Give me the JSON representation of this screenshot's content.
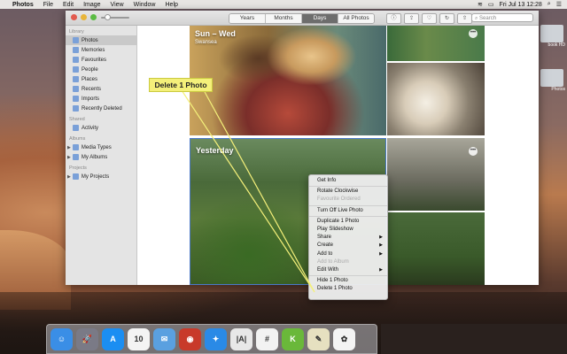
{
  "menubar": {
    "app_name": "Photos",
    "items": [
      "File",
      "Edit",
      "Image",
      "View",
      "Window",
      "Help"
    ],
    "clock": "Fri Jul 13  12:28"
  },
  "toolbar": {
    "segments": [
      {
        "label": "Years",
        "active": false
      },
      {
        "label": "Months",
        "active": false
      },
      {
        "label": "Days",
        "active": true
      },
      {
        "label": "All Photos",
        "active": false
      }
    ],
    "search_placeholder": "Search"
  },
  "sidebar": {
    "sections": [
      {
        "title": "Library",
        "items": [
          {
            "label": "Photos",
            "selected": true,
            "icon": "photos-icon"
          },
          {
            "label": "Memories",
            "icon": "memories-icon"
          },
          {
            "label": "Favourites",
            "icon": "heart-icon"
          },
          {
            "label": "People",
            "icon": "people-icon"
          },
          {
            "label": "Places",
            "icon": "pin-icon"
          },
          {
            "label": "Recents",
            "icon": "clock-icon"
          },
          {
            "label": "Imports",
            "icon": "import-icon"
          },
          {
            "label": "Recently Deleted",
            "icon": "trash-icon"
          }
        ]
      },
      {
        "title": "Shared",
        "items": [
          {
            "label": "Activity",
            "icon": "cloud-icon"
          }
        ]
      },
      {
        "title": "Albums",
        "items": [
          {
            "label": "Media Types",
            "icon": "folder-icon",
            "disclosure": true
          },
          {
            "label": "My Albums",
            "icon": "folder-icon",
            "disclosure": true
          }
        ]
      },
      {
        "title": "Projects",
        "items": [
          {
            "label": "My Projects",
            "icon": "folder-icon",
            "disclosure": true
          }
        ]
      }
    ]
  },
  "content": {
    "group1_title": "Sun – Wed",
    "group1_subtitle": "Swansea",
    "group2_title": "Yesterday"
  },
  "context_menu": {
    "items": [
      {
        "label": "Get Info"
      },
      {
        "sep": true
      },
      {
        "label": "Rotate Clockwise"
      },
      {
        "label": "Favourite Ordered",
        "disabled": true
      },
      {
        "sep": true
      },
      {
        "label": "Turn Off Live Photo"
      },
      {
        "sep": true
      },
      {
        "label": "Duplicate 1 Photo"
      },
      {
        "label": "Play Slideshow"
      },
      {
        "label": "Share",
        "submenu": true
      },
      {
        "label": "Create",
        "submenu": true
      },
      {
        "label": "Add to",
        "submenu": true
      },
      {
        "label": "Add to Album",
        "disabled": true
      },
      {
        "label": "Edit With",
        "submenu": true
      },
      {
        "sep": true
      },
      {
        "label": "Hide 1 Photo"
      },
      {
        "label": "Delete 1 Photo"
      }
    ]
  },
  "callout": {
    "label": "Delete 1 Photo"
  },
  "desktop": {
    "icon_labels": [
      "book HD",
      "Photos"
    ]
  },
  "dock": {
    "apps": [
      {
        "name": "finder-icon",
        "color": "#3a8ee6",
        "glyph": "☺"
      },
      {
        "name": "launchpad-icon",
        "color": "#7a7a86",
        "glyph": "🚀"
      },
      {
        "name": "app-store-icon",
        "color": "#1b8ef2",
        "glyph": "A"
      },
      {
        "name": "calendar-icon",
        "color": "#f4f4f4",
        "glyph": "10"
      },
      {
        "name": "mail-icon",
        "color": "#5aa0e0",
        "glyph": "✉"
      },
      {
        "name": "photo-booth-icon",
        "color": "#c83a2a",
        "glyph": "◉"
      },
      {
        "name": "safari-icon",
        "color": "#2a8ae6",
        "glyph": "✦"
      },
      {
        "name": "text-edit-icon",
        "color": "#e8e8e8",
        "glyph": "|A|"
      },
      {
        "name": "slack-icon",
        "color": "#f2f2f2",
        "glyph": "#"
      },
      {
        "name": "keynote-icon",
        "color": "#6ab83a",
        "glyph": "K"
      },
      {
        "name": "notes-icon",
        "color": "#e6e0c0",
        "glyph": "✎"
      },
      {
        "name": "photos-app-icon",
        "color": "#f4f4f4",
        "glyph": "✿"
      }
    ]
  }
}
